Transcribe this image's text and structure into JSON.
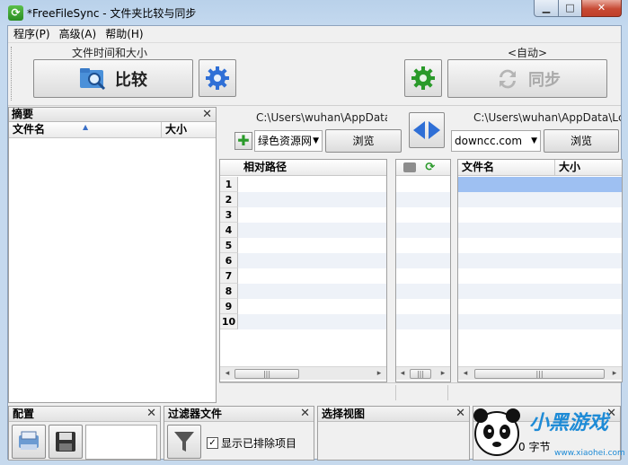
{
  "window": {
    "title": "*FreeFileSync - 文件夹比较与同步",
    "app_icon": "sync-icon",
    "controls": {
      "minimize": "▁",
      "maximize": "□",
      "close": "✕"
    }
  },
  "menu": [
    "程序(P)",
    "高级(A)",
    "帮助(H)"
  ],
  "toolbar": {
    "compare_caption": "文件时间和大小",
    "compare_label": "比较",
    "sync_caption": "<自动>",
    "sync_label": "同步"
  },
  "summary_panel": {
    "title": "摘要",
    "col_filename": "文件名",
    "col_size": "大小"
  },
  "left": {
    "path": "C:\\Users\\wuhan\\AppData\\Lc",
    "combo_value": "绿色资源网",
    "browse": "浏览",
    "col_relpath": "相对路径",
    "rows": [
      "1",
      "2",
      "3",
      "4",
      "5",
      "6",
      "7",
      "8",
      "9",
      "10"
    ]
  },
  "middle": {
    "header_icons": [
      "camera-icon",
      "sync-icon"
    ]
  },
  "right": {
    "path": "C:\\Users\\wuhan\\AppData\\Lc",
    "combo_value": "downcc.com",
    "browse": "浏览",
    "col_filename": "文件名",
    "col_size": "大小"
  },
  "bottom": {
    "config_title": "配置",
    "filter_title": "过滤器文件",
    "show_excluded": "显示已排除项目",
    "view_title": "选择视图",
    "stats_text": "0 字节"
  },
  "watermark": {
    "text": "小黑游戏",
    "url": "www.xiaohei.com"
  },
  "colors": {
    "accent_blue": "#2f6fd6",
    "gear_green": "#2a9a2a",
    "selection": "#9ec0f2",
    "stripe": "#eef2f8"
  }
}
